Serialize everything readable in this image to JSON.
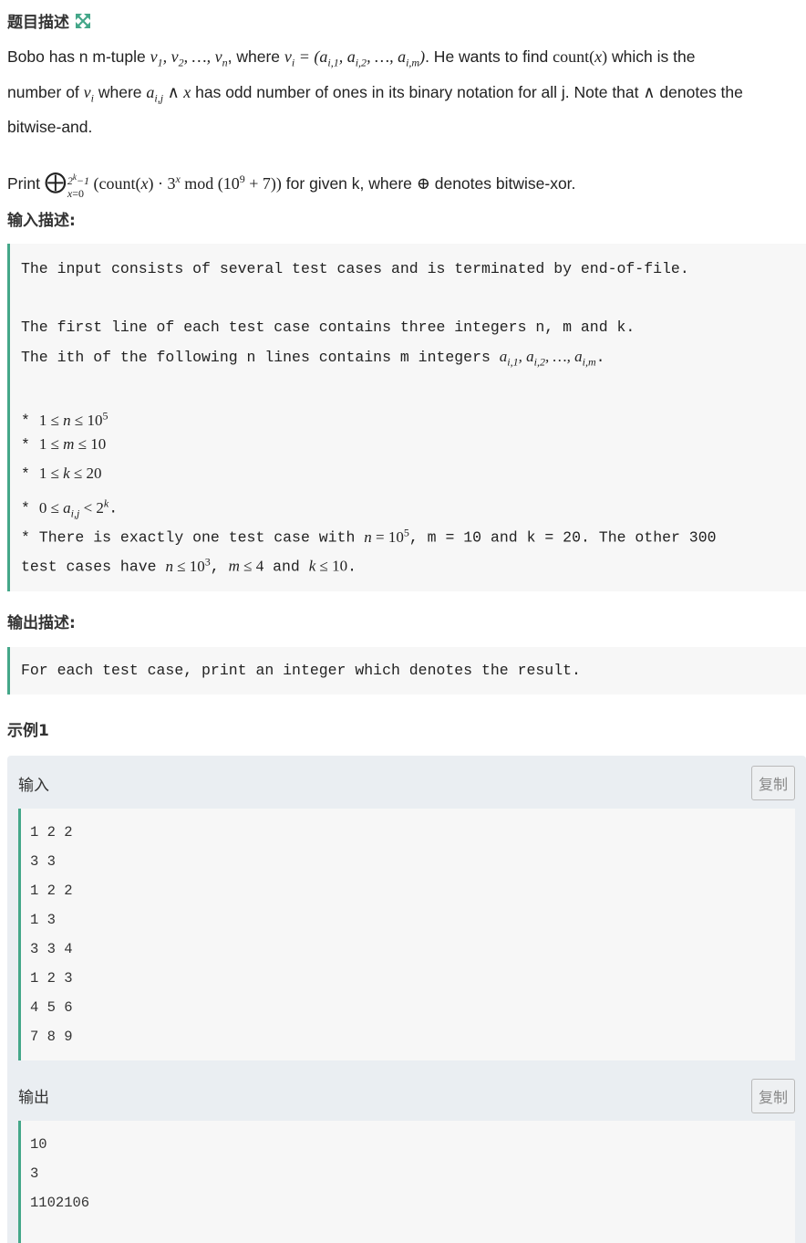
{
  "headings": {
    "description": "题目描述",
    "input": "输入描述:",
    "output": "输出描述:",
    "example": "示例1"
  },
  "icons": {
    "expand": "expand-arrows-icon"
  },
  "colors": {
    "accent": "#44a789",
    "pre_bg": "#f7f7f7",
    "sample_bg": "#eaeef2"
  },
  "description": {
    "p1_a": "Bobo has n m-tuple ",
    "p1_b": ", where ",
    "p1_c": ". He wants to find ",
    "p1_d": " which is the",
    "p1_e": "number of ",
    "p1_f": " where ",
    "p1_g": " has odd number of ones in its binary notation for all j. Note that ",
    "p1_h": " denotes the",
    "p1_i": "bitwise-and.",
    "p2_a": "Print ",
    "p2_b": " for given k, where ",
    "p2_c": " denotes bitwise-xor."
  },
  "input_desc": {
    "line1": "The input consists of several test cases and is terminated by end-of-file.",
    "line2": "The first line of each test case contains three integers n, m and k.",
    "line3": "The ith of the following n lines contains m integers ",
    "line3_end": ".",
    "bullet": "* ",
    "line8_a": "* There is exactly one test case with ",
    "line8_b": ", m = 10 and k = 20. The other 300",
    "line9_a": "test cases have ",
    "line9_b": ", ",
    "line9_c": " and ",
    "line9_d": "."
  },
  "output_desc": {
    "line1": "For each test case, print an integer which denotes the result."
  },
  "sample": {
    "input_label": "输入",
    "output_label": "输出",
    "copy_label": "复制",
    "input_lines": [
      "1 2 2",
      "3 3",
      "1 2 2",
      "1 3",
      "3 3 4",
      "1 2 3",
      "4 5 6",
      "7 8 9"
    ],
    "output_lines": [
      "10",
      "3",
      "1102106"
    ]
  }
}
